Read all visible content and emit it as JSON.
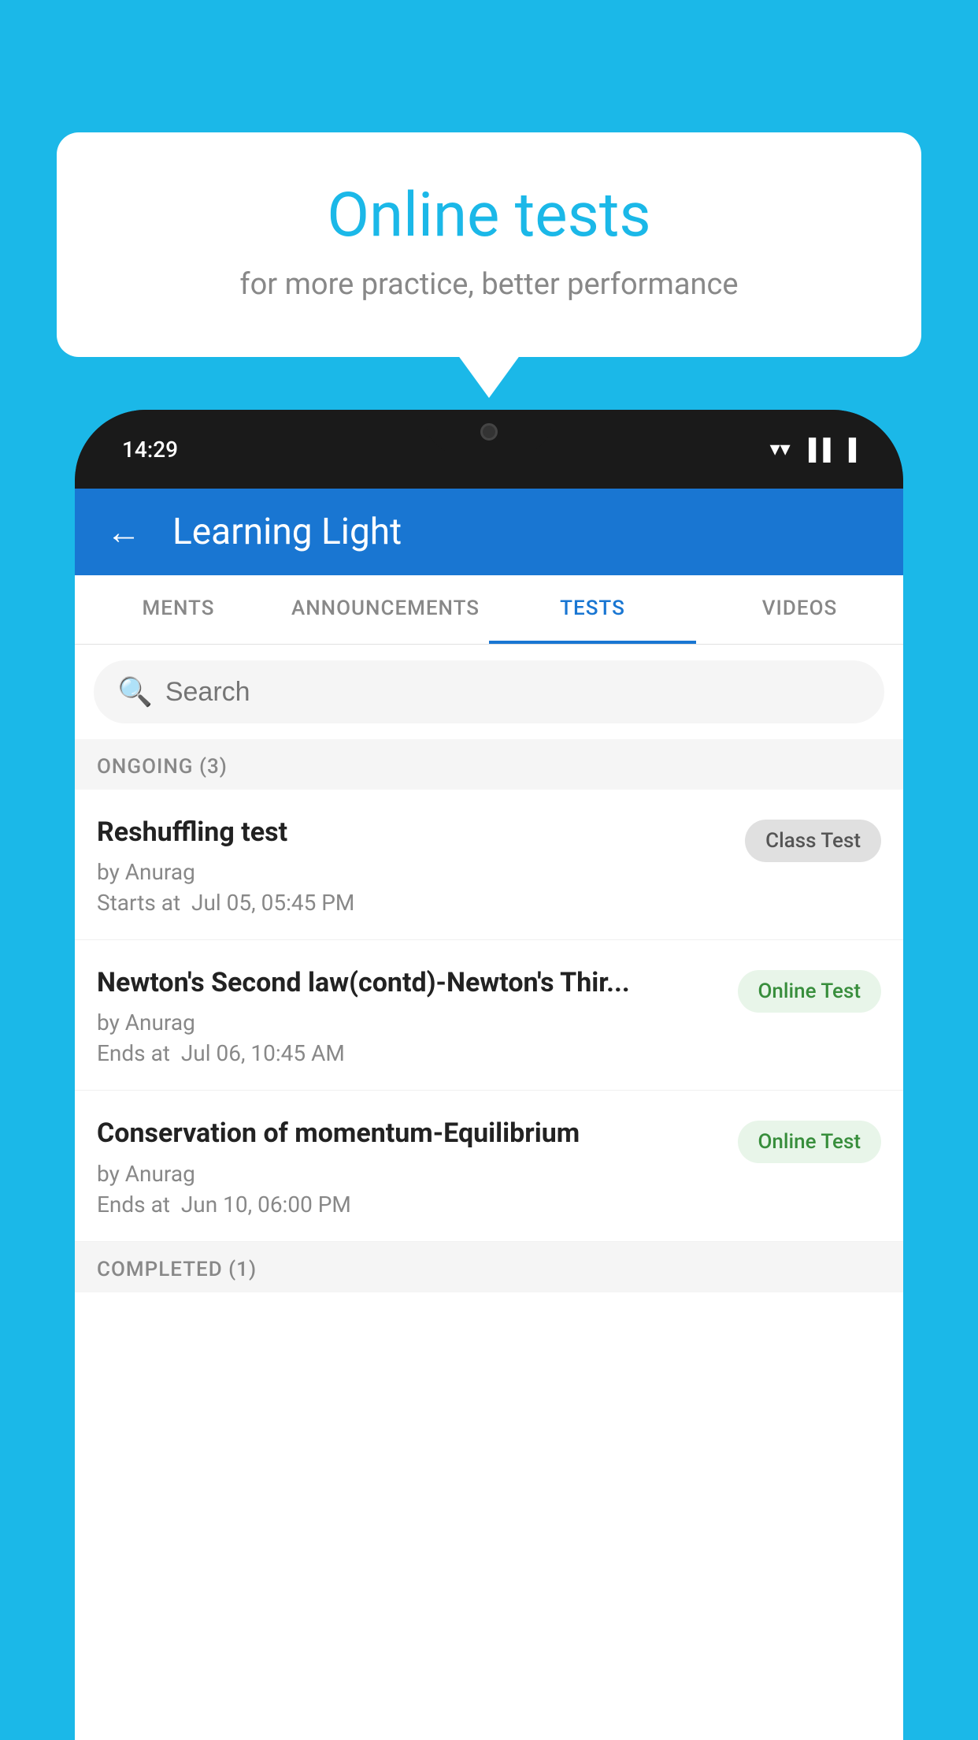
{
  "background": {
    "color": "#1bb8e8"
  },
  "speech_bubble": {
    "title": "Online tests",
    "subtitle": "for more practice, better performance"
  },
  "status_bar": {
    "time": "14:29",
    "wifi_icon": "▼",
    "signal_icon": "▲▲",
    "battery_icon": "▐"
  },
  "app_header": {
    "back_label": "←",
    "title": "Learning Light"
  },
  "tabs": [
    {
      "label": "MENTS",
      "active": false
    },
    {
      "label": "ANNOUNCEMENTS",
      "active": false
    },
    {
      "label": "TESTS",
      "active": true
    },
    {
      "label": "VIDEOS",
      "active": false
    }
  ],
  "search": {
    "placeholder": "Search"
  },
  "ongoing_section": {
    "label": "ONGOING (3)"
  },
  "test_items": [
    {
      "name": "Reshuffling test",
      "by": "by Anurag",
      "time_label": "Starts at",
      "time": "Jul 05, 05:45 PM",
      "badge": "Class Test",
      "badge_type": "class"
    },
    {
      "name": "Newton's Second law(contd)-Newton's Thir...",
      "by": "by Anurag",
      "time_label": "Ends at",
      "time": "Jul 06, 10:45 AM",
      "badge": "Online Test",
      "badge_type": "online"
    },
    {
      "name": "Conservation of momentum-Equilibrium",
      "by": "by Anurag",
      "time_label": "Ends at",
      "time": "Jun 10, 06:00 PM",
      "badge": "Online Test",
      "badge_type": "online"
    }
  ],
  "completed_section": {
    "label": "COMPLETED (1)"
  }
}
